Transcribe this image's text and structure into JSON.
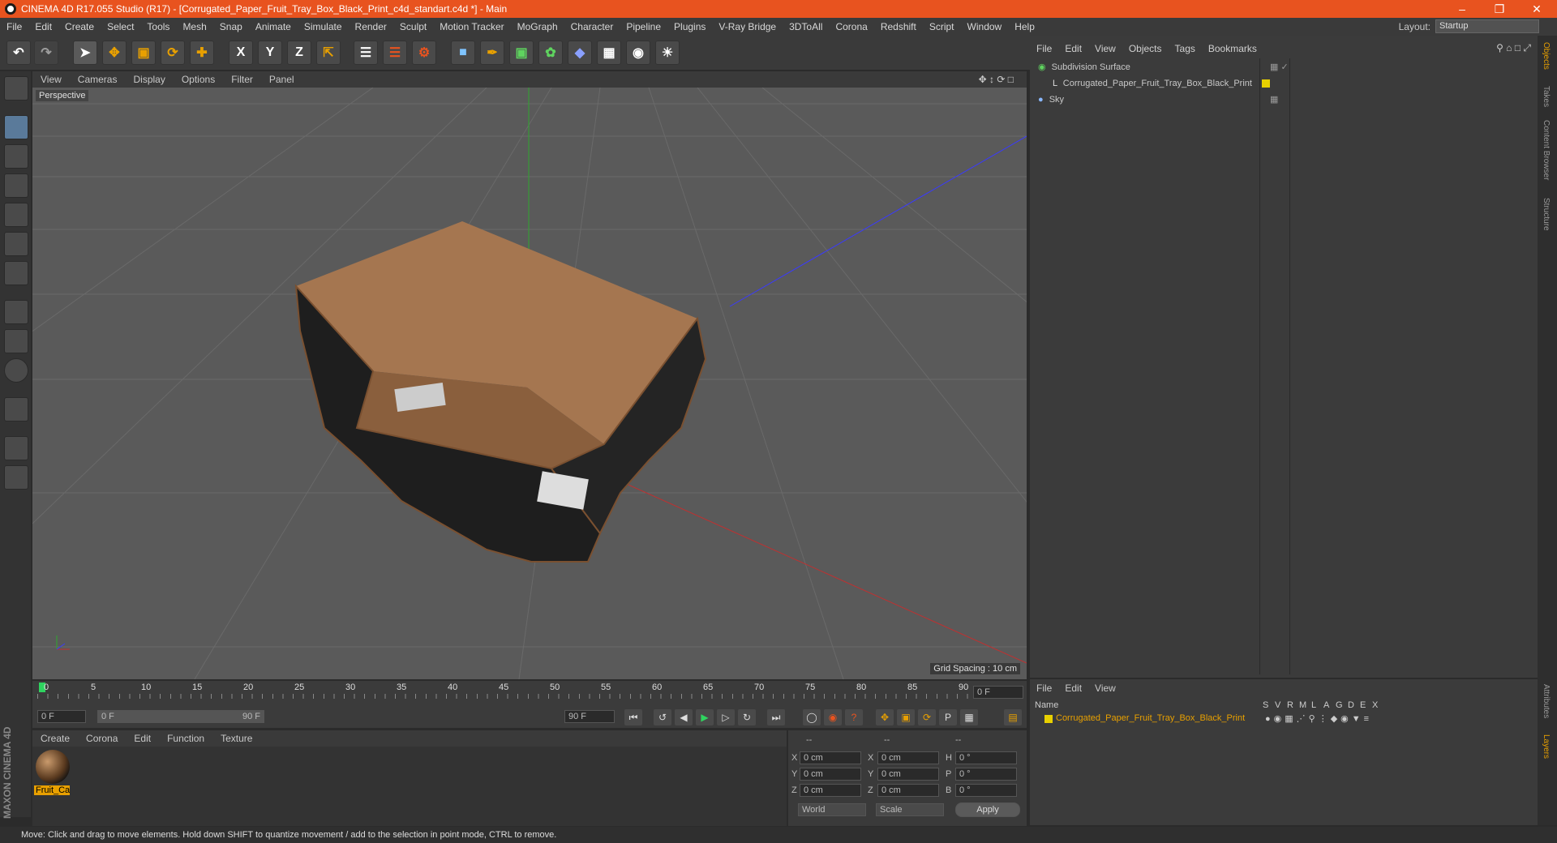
{
  "window": {
    "title": "CINEMA 4D R17.055 Studio (R17) - [Corrugated_Paper_Fruit_Tray_Box_Black_Print_c4d_standart.c4d *] - Main"
  },
  "menubar": [
    "File",
    "Edit",
    "Create",
    "Select",
    "Tools",
    "Mesh",
    "Snap",
    "Animate",
    "Simulate",
    "Render",
    "Sculpt",
    "Motion Tracker",
    "MoGraph",
    "Character",
    "Pipeline",
    "Plugins",
    "V-Ray Bridge",
    "3DToAll",
    "Corona",
    "Redshift",
    "Script",
    "Window",
    "Help"
  ],
  "layout": {
    "label": "Layout:",
    "value": "Startup"
  },
  "toolbar": {
    "x": "X",
    "y": "Y",
    "z": "Z"
  },
  "viewport": {
    "menu": [
      "View",
      "Cameras",
      "Display",
      "Options",
      "Filter",
      "Panel"
    ],
    "name": "Perspective",
    "grid_spacing": "Grid Spacing : 10 cm"
  },
  "timeline": {
    "ticks": [
      "0",
      "5",
      "10",
      "15",
      "20",
      "25",
      "30",
      "35",
      "40",
      "45",
      "50",
      "55",
      "60",
      "65",
      "70",
      "75",
      "80",
      "85",
      "90"
    ],
    "current_frame": "0 F",
    "start_field": "0 F",
    "range_start": "0 F",
    "range_end": "90 F",
    "end_field": "90 F"
  },
  "material_manager": {
    "menu": [
      "Create",
      "Corona",
      "Edit",
      "Function",
      "Texture"
    ],
    "materials": [
      {
        "name": "Fruit_Ca"
      }
    ]
  },
  "coordinates": {
    "headers": [
      "--",
      "--",
      "--"
    ],
    "rows": [
      {
        "a": "X",
        "av": "0 cm",
        "b": "X",
        "bv": "0 cm",
        "c": "H",
        "cv": "0 °"
      },
      {
        "a": "Y",
        "av": "0 cm",
        "b": "Y",
        "bv": "0 cm",
        "c": "P",
        "cv": "0 °"
      },
      {
        "a": "Z",
        "av": "0 cm",
        "b": "Z",
        "bv": "0 cm",
        "c": "B",
        "cv": "0 °"
      }
    ],
    "world": "World",
    "scale": "Scale",
    "apply": "Apply"
  },
  "object_manager": {
    "menu": [
      "File",
      "Edit",
      "View",
      "Objects",
      "Tags",
      "Bookmarks"
    ],
    "objects": [
      {
        "name": "Subdivision Surface"
      },
      {
        "name": "Corrugated_Paper_Fruit_Tray_Box_Black_Print"
      },
      {
        "name": "Sky"
      }
    ]
  },
  "layer_manager": {
    "menu": [
      "File",
      "Edit",
      "View"
    ],
    "columns": [
      "Name",
      "S",
      "V",
      "R",
      "M",
      "L",
      "A",
      "G",
      "D",
      "E",
      "X"
    ],
    "layers": [
      {
        "name": "Corrugated_Paper_Fruit_Tray_Box_Black_Print",
        "color": "#e8d000"
      }
    ]
  },
  "side_tabs": [
    "Objects",
    "Takes",
    "Content Browser",
    "Structure"
  ],
  "side_tabs_bottom": [
    "Attributes",
    "Layers"
  ],
  "brand": {
    "maxon": "MAXON",
    "product": "CINEMA 4D"
  },
  "status": "Move: Click and drag to move elements. Hold down SHIFT to quantize movement / add to the selection in point mode, CTRL to remove.",
  "colors": {
    "titlebar": "#e8531f",
    "accent": "#e8a000",
    "viewport": "#5a5a5a"
  }
}
